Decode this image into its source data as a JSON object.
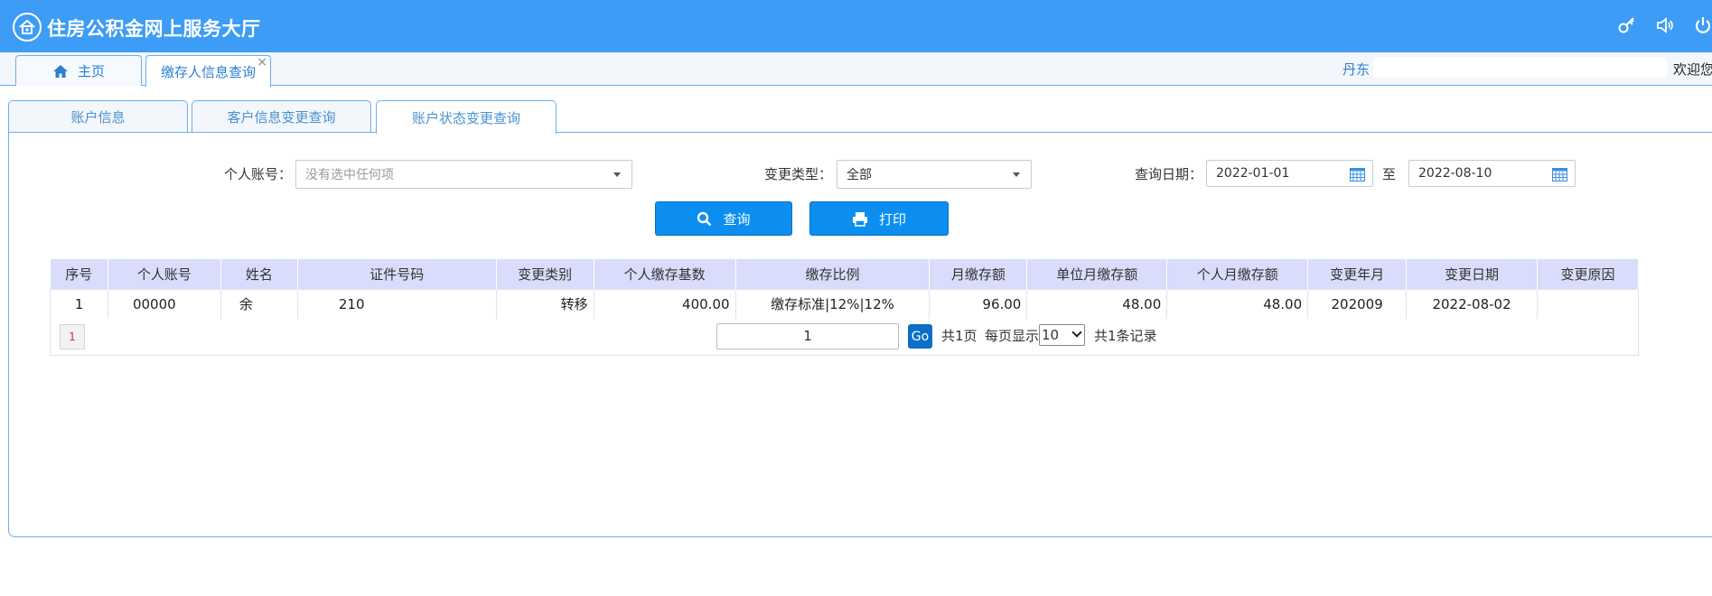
{
  "header": {
    "title": "住房公积金网上服务大厅",
    "icons": [
      "key-icon",
      "speaker-icon",
      "power-icon"
    ],
    "color": "#3d9cf5"
  },
  "navtabs": {
    "home_label": "主页",
    "current_label": "缴存人信息查询",
    "close_glyph": "×",
    "location": "丹东",
    "welcome": "欢迎您"
  },
  "subtabs": {
    "items": [
      "账户信息",
      "客户信息变更查询",
      "账户状态变更查询"
    ],
    "active": "账户状态变更查询"
  },
  "form": {
    "account_label": "个人账号：",
    "account_placeholder": "没有选中任何项",
    "change_type_label": "变更类型：",
    "change_type_value": "全部",
    "date_label": "查询日期：",
    "date_from": "2022-01-01",
    "date_to_label": "至",
    "date_to": "2022-08-10",
    "query_button": "查询",
    "print_button": "打印"
  },
  "table": {
    "columns": [
      "序号",
      "个人账号",
      "姓名",
      "证件号码",
      "变更类别",
      "个人缴存基数",
      "缴存比例",
      "月缴存额",
      "单位月缴存额",
      "个人月缴存额",
      "变更年月",
      "变更日期",
      "变更原因"
    ],
    "rows": [
      [
        "1",
        "00000",
        "余",
        "210",
        "转移",
        "400.00",
        "缴存标准|12%|12%",
        "96.00",
        "48.00",
        "48.00",
        "202009",
        "2022-08-02",
        ""
      ]
    ]
  },
  "pager": {
    "current_page_badge": "1",
    "page_input": "1",
    "go_label": "Go",
    "total_pages": "共1页",
    "per_page_label": "每页显示",
    "per_page_value": "10",
    "total_records": "共1条记录"
  }
}
